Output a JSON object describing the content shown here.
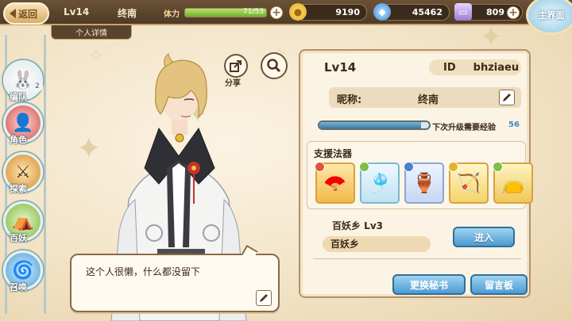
{
  "topbar": {
    "back_label": "返回",
    "level": "Lv14",
    "name": "终南",
    "detail_tab": "个人详情",
    "stamina_label": "体力",
    "stamina_value": "71/53",
    "stamina_fraction": 1.0,
    "gold": "9190",
    "gems": "45462",
    "tickets": "809",
    "home_label": "主界面"
  },
  "sidebar": {
    "items": [
      {
        "label": "编队",
        "badge": "2"
      },
      {
        "label": "角色"
      },
      {
        "label": "探索"
      },
      {
        "label": "百妖"
      },
      {
        "label": "召唤"
      }
    ]
  },
  "share_label": "分享",
  "dialog": {
    "text": "这个人很懒，什么都没留下"
  },
  "panel": {
    "level": "Lv14",
    "id_label": "ID",
    "id_value": "bhziaeu",
    "nickname_label": "昵称:",
    "nickname_value": "终南",
    "exp_label": "下次升级需要经验",
    "exp_value": "56",
    "exp_fraction": 0.93,
    "support_title": "支援法器",
    "yokai_title": "百妖乡  Lv3",
    "yokai_name": "百妖乡",
    "enter_button": "进入",
    "change_secretary_button": "更换秘书",
    "message_board_button": "留言板"
  },
  "colors": {
    "accent_blue": "#4d9bd2",
    "panel_border": "#b2916a",
    "exp_value": "#3a8dc8"
  }
}
